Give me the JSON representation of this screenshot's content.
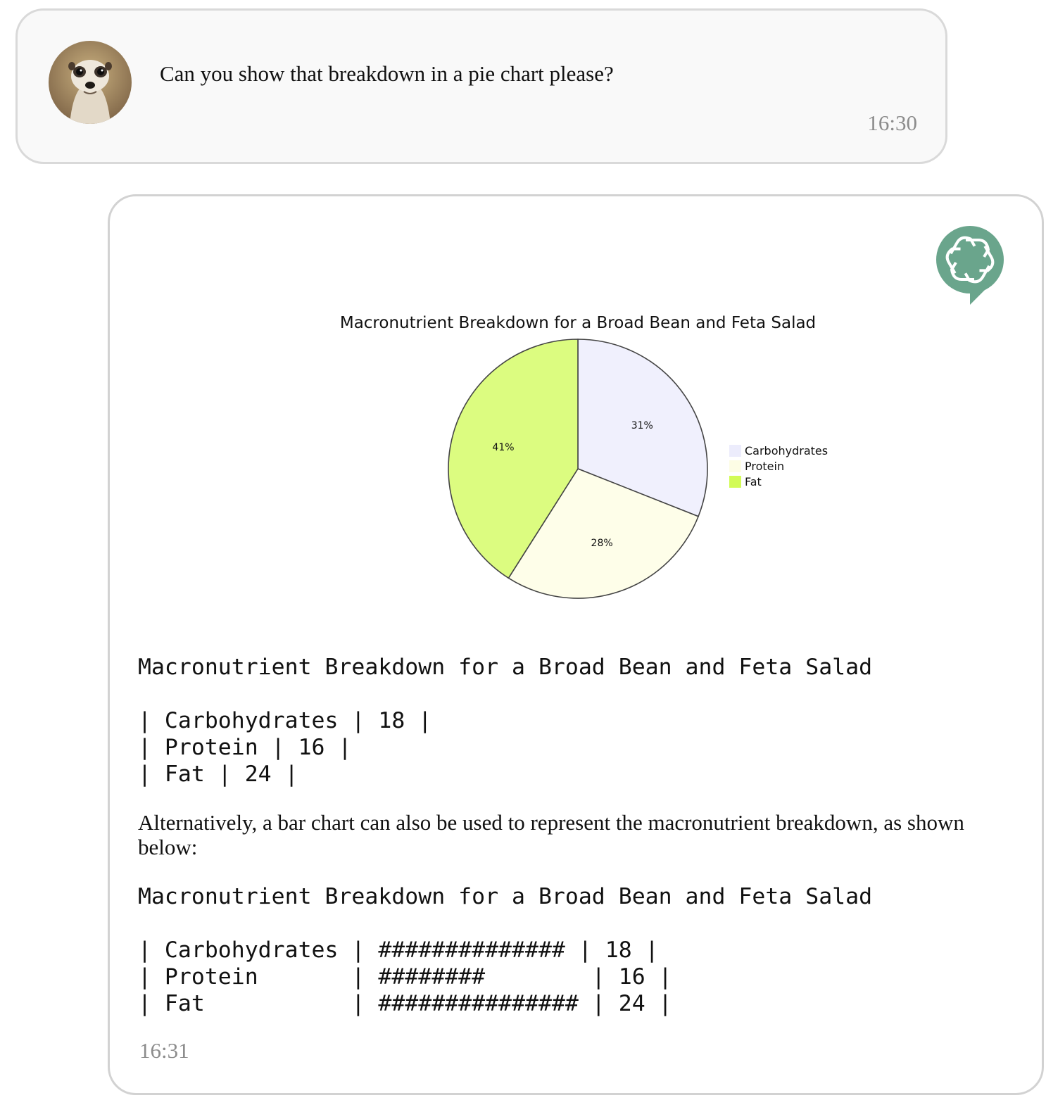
{
  "user_message": {
    "avatar_icon": "meerkat-avatar",
    "text": "Can you show that breakdown in a pie chart please?",
    "time": "16:30"
  },
  "assistant_message": {
    "logo_icon": "openai-logo-icon",
    "logo_color": "#6aa58c",
    "table_title": "Macronutrient Breakdown for a Broad Bean and Feta Salad",
    "table_rows": [
      "| Carbohydrates | 18 |",
      "| Protein | 16 |",
      "| Fat | 24 |"
    ],
    "paragraph": "Alternatively, a bar chart can also be used to represent the macronutrient breakdown, as shown below:",
    "bar_title": "Macronutrient Breakdown for a Broad Bean and Feta Salad",
    "bar_rows": [
      "| Carbohydrates | ############## | 18 |",
      "| Protein       | ########        | 16 |",
      "| Fat           | ############### | 24 |"
    ],
    "time": "16:31"
  },
  "chart_data": {
    "type": "pie",
    "title": "Macronutrient Breakdown for a Broad Bean and Feta Salad",
    "categories": [
      "Carbohydrates",
      "Protein",
      "Fat"
    ],
    "values": [
      31,
      28,
      41
    ],
    "labels": [
      "31%",
      "28%",
      "41%"
    ],
    "colors": [
      "#f0f0fd",
      "#fefee9",
      "#dcfc80"
    ],
    "legend_colors": [
      "#ececfc",
      "#fdfde5",
      "#d2fb56"
    ],
    "outline_color": "#444444",
    "legend_position": "right"
  }
}
